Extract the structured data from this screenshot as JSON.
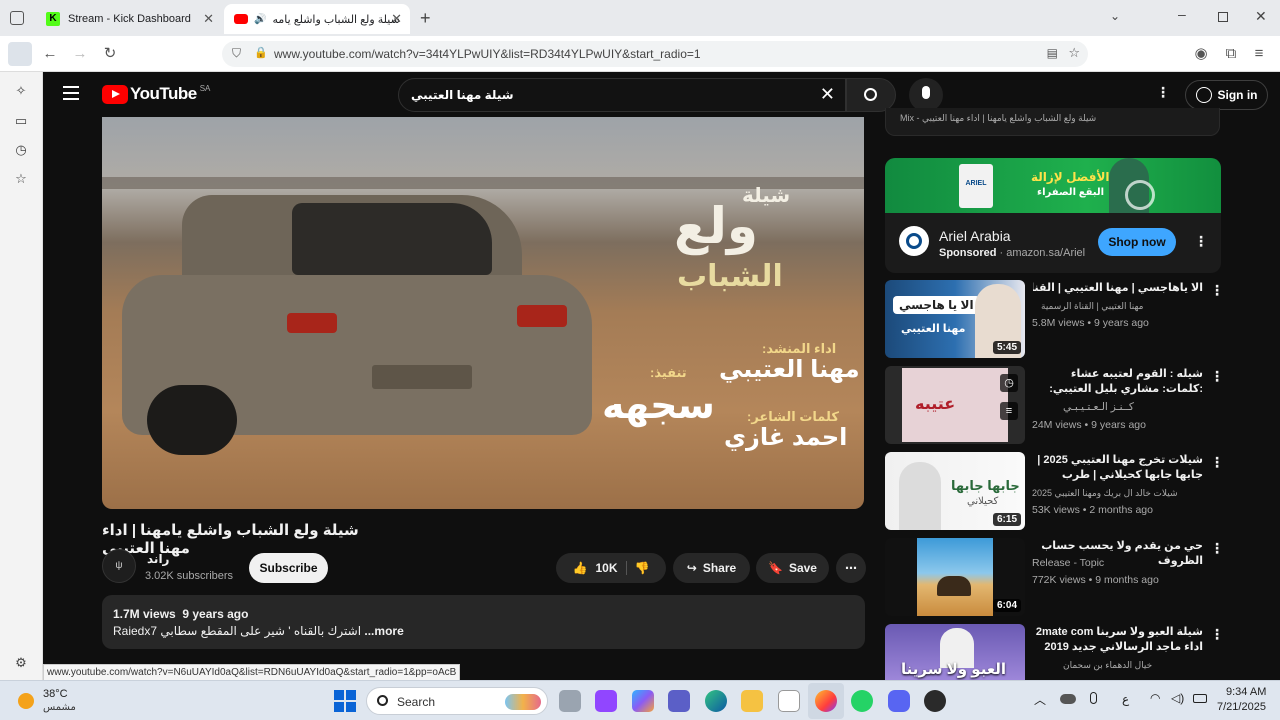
{
  "browser": {
    "tabs": [
      {
        "label": "Stream - Kick Dashboard",
        "active": false
      },
      {
        "label": "شيلة ولع الشباب واشلع يامه",
        "active": true
      }
    ],
    "new_tab": "+",
    "url": "www.youtube.com/watch?v=34t4YLPwUIY&list=RD34t4YLPwUIY&start_radio=1",
    "status_url": "www.youtube.com/watch?v=N6uUAYId0aQ&list=RDN6uUAYId0aQ&start_radio=1&pp=oAcB"
  },
  "youtube": {
    "logo_text": "YouTube",
    "region": "SA",
    "search_value": "شيلة مهنا العتيبي",
    "sign_in": "Sign in",
    "video": {
      "title": "شيلة ولع الشباب واشلع يامهنا | اداء مهنا العتيبي",
      "overlay_title_1": "شيلة",
      "overlay_title_2": "ولع",
      "overlay_title_3": "الشباب",
      "overlay_perf_label": "اداء المنشد:",
      "overlay_perf_name": "مهنا العتيبي",
      "overlay_exec_label": "تنفيذ:",
      "overlay_exec_name": "سجهه",
      "overlay_poet_label": "كلمات الشاعر:",
      "overlay_poet_name": "احمد غازي",
      "channel": "راند",
      "subscribers": "3.02K subscribers",
      "subscribe": "Subscribe",
      "likes": "10K",
      "share": "Share",
      "save": "Save",
      "views": "1.7M views",
      "age": "9 years ago",
      "description": "Raiedx7 اشترك بالقناه ' شير على المقطع سطابي",
      "more": "...more"
    },
    "mix_header": "Mix - شيلة ولع الشباب واشلع يامهنا | اداء مهنا العتيبي",
    "ad": {
      "banner_line1": "الأفضل لإزالة",
      "banner_line2": "البقع الصفراء",
      "brand_badge": "ARIEL",
      "name": "Ariel Arabia",
      "sponsored": "Sponsored",
      "domain": "amazon.sa/Ariel",
      "cta": "Shop now"
    },
    "recommendations": [
      {
        "title": "الا ياهاجسي | مهنا العتيبي | القناة الرسمية",
        "channel": "مهنا العتيبي | القناة الرسمية",
        "meta": "5.8M views • 9 years ago",
        "duration": "5:45",
        "thumb_text": "الا يا هاجسي",
        "thumb_sub": "مهنا العتيبي"
      },
      {
        "title": "شيله : القوم لعتيبه عشاء :كلمات: مشاري بليل العتيبي: اداء : عبدالعزيز اليامي",
        "channel": "كــنـز الـعـتـيـبـي",
        "meta": "24M views • 9 years ago",
        "duration": "",
        "thumb_text": "عتيبه",
        "thumb_sub": ""
      },
      {
        "title": "شيلات تخرج مهنا العتيبي 2025 | جابها جابها كحيلاني | طرب شيلات مهنا العتيبي",
        "channel": "شيلات خالد ال بريك ومهنا العتيبي 2025",
        "meta": "53K views • 2 months ago",
        "duration": "6:15",
        "thumb_text": "جابها جابها",
        "thumb_sub": "كحيلاني"
      },
      {
        "title": "حي من يقدم ولا يحسب حساب الظروف",
        "channel": "Release - Topic",
        "meta": "772K views • 9 months ago",
        "duration": "6:04",
        "thumb_text": "",
        "thumb_sub": ""
      },
      {
        "title": "شيلة العبو ولا سرينا 2mate com اداء ماجد الرسالاني جديد 2019",
        "channel": "خيال الدهماء بن سحمان",
        "meta": "",
        "duration": "",
        "thumb_text": "العبو ولا سرينا",
        "thumb_sub": ""
      }
    ]
  },
  "taskbar": {
    "weather_temp": "38°C",
    "weather_desc": "مشمس",
    "search": "Search",
    "lang": "ع",
    "time": "9:34 AM",
    "date": "7/21/2025"
  }
}
